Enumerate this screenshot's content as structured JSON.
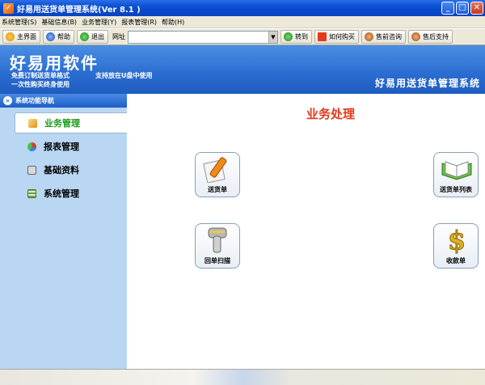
{
  "window": {
    "title": "好易用送货单管理系统(Ver 8.1 )"
  },
  "menu": [
    {
      "label": "系统管理(S)"
    },
    {
      "label": "基础信息(B)"
    },
    {
      "label": "业务管理(Y)"
    },
    {
      "label": "报表管理(R)"
    },
    {
      "label": "帮助(H)"
    }
  ],
  "toolbar": {
    "home": "主界面",
    "help": "帮助",
    "exit": "退出",
    "address_label": "网址",
    "address_value": "",
    "go": "转到",
    "buy": "如何购买",
    "presales": "售前咨询",
    "aftersales": "售后支持"
  },
  "banner": {
    "brand": "好易用软件",
    "tagline1": "免费订制送货单格式",
    "tagline2": "支持放在U盘中使用",
    "tagline3": "一次性购买终身使用",
    "system_name": "好易用送货单管理系统"
  },
  "sidebar": {
    "header": "系统功能导航",
    "items": [
      {
        "label": "业务管理",
        "active": true,
        "icon": "business-icon"
      },
      {
        "label": "报表管理",
        "active": false,
        "icon": "pie-chart-icon"
      },
      {
        "label": "基础资料",
        "active": false,
        "icon": "folder-icon"
      },
      {
        "label": "系统管理",
        "active": false,
        "icon": "grid-icon"
      }
    ]
  },
  "main": {
    "title": "业务处理",
    "tiles": [
      {
        "label": "送货单",
        "icon": "pen-paper-icon"
      },
      {
        "label": "送货单列表",
        "icon": "open-book-icon"
      },
      {
        "label": "回单扫描",
        "icon": "barcode-scanner-icon"
      },
      {
        "label": "收款单",
        "icon": "dollar-icon"
      }
    ]
  },
  "colors": {
    "title_accent": "#e23a1a",
    "active_nav": "#1a9a1a",
    "banner_blue": "#2a6cd0",
    "sidebar_bg": "#b9d6f2"
  }
}
